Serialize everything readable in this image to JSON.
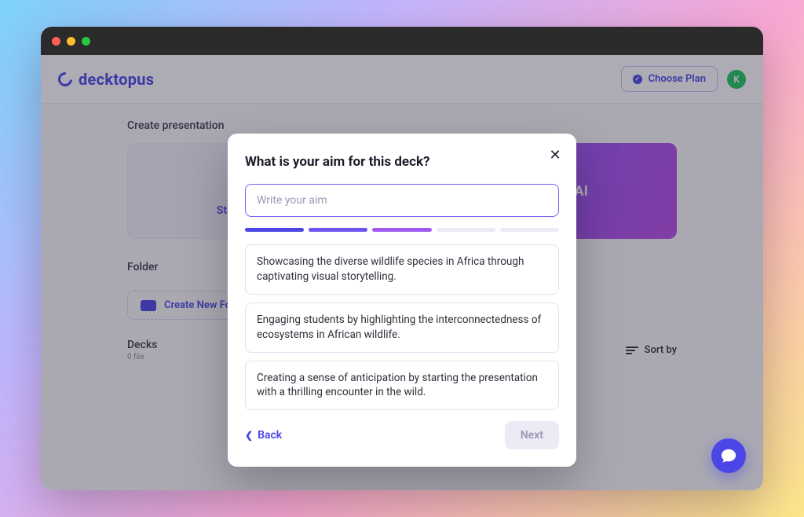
{
  "brand": {
    "name": "decktopus"
  },
  "topbar": {
    "plan_label": "Choose Plan",
    "avatar_initial": "K"
  },
  "sections": {
    "create_label": "Create presentation",
    "folder_label": "Folder",
    "decks_label": "Decks",
    "decks_meta": "0 file"
  },
  "cards": {
    "blank_label": "Start from scratch",
    "ai_label": "Create with AI"
  },
  "folder": {
    "create_label": "Create New Folder"
  },
  "sort": {
    "label": "Sort by"
  },
  "modal": {
    "title": "What is your aim for this deck?",
    "placeholder": "Write your aim",
    "options": [
      "Showcasing the diverse wildlife species in Africa through captivating visual storytelling.",
      "Engaging students by highlighting the interconnectedness of ecosystems in African wildlife.",
      "Creating a sense of anticipation by starting the presentation with a thrilling encounter in the wild."
    ],
    "back_label": "Back",
    "next_label": "Next",
    "progress_active": 3,
    "progress_total": 5
  },
  "colors": {
    "primary": "#4b46e5",
    "accent_gradient_start": "#7c5cff",
    "accent_gradient_end": "#b94be5"
  }
}
